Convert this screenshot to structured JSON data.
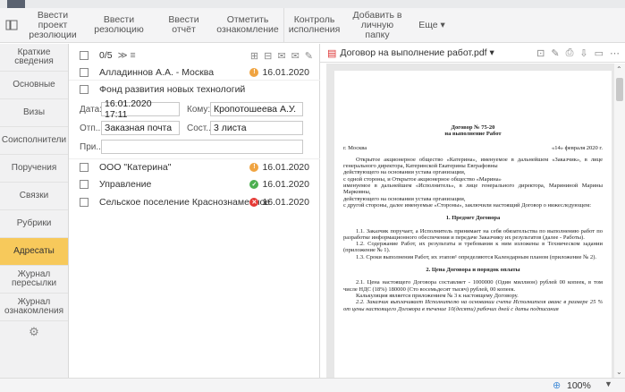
{
  "toolbar": {
    "items": [
      {
        "label1": "Ввести проект",
        "label2": "резолюции"
      },
      {
        "label1": "Ввести",
        "label2": "резолюцию"
      },
      {
        "label1": "Ввести отчёт",
        "label2": ""
      },
      {
        "label1": "Отметить",
        "label2": "ознакомление"
      },
      {
        "label1": "Контроль",
        "label2": "исполнения"
      },
      {
        "label1": "Добавить в",
        "label2": "личную папку"
      },
      {
        "label1": "Еще ▾",
        "label2": ""
      }
    ]
  },
  "sidebar": {
    "items": [
      {
        "l1": "Краткие",
        "l2": "сведения"
      },
      {
        "l1": "Основные",
        "l2": ""
      },
      {
        "l1": "Визы",
        "l2": ""
      },
      {
        "l1": "Соисполнители",
        "l2": ""
      },
      {
        "l1": "Поручения",
        "l2": ""
      },
      {
        "l1": "Связки",
        "l2": ""
      },
      {
        "l1": "Рубрики",
        "l2": ""
      },
      {
        "l1": "Адресаты",
        "l2": ""
      },
      {
        "l1": "Журнал",
        "l2": "пересылки"
      },
      {
        "l1": "Журнал",
        "l2": "ознакомления"
      }
    ],
    "active": "Адресаты",
    "gear_icon": "gear-icon"
  },
  "middle": {
    "counter": "0/5",
    "counter_arrow": "≫ ≡",
    "rows": [
      {
        "name": "Алладиннов А.А. - Москва",
        "date": "16.01.2020",
        "status_color": "#f0a441",
        "status_glyph": "!"
      },
      {
        "name": "Фонд развития новых технологий",
        "date": "",
        "status_color": "",
        "status_glyph": ""
      }
    ],
    "detail": {
      "date_label": "Дата:",
      "date_value": "16.01.2020 17:11",
      "to_label": "Кому:",
      "to_value": "Кропотошеева А.У.",
      "sent_label": "Отп...",
      "sent_value": "Заказная почта",
      "comp_label": "Сост...",
      "comp_value": "3 листа",
      "note_label": "При...",
      "note_value": ""
    },
    "rows2": [
      {
        "name": "ООО \"Катерина\"",
        "date": "16.01.2020",
        "status_color": "#f0a441",
        "status_glyph": "!"
      },
      {
        "name": "Управление",
        "date": "16.01.2020",
        "status_color": "#4caf50",
        "status_glyph": "✓"
      },
      {
        "name": "Сельское поселение Краснознаменное",
        "date": "16.01.2020",
        "status_color": "#e53935",
        "status_glyph": "✕"
      }
    ]
  },
  "viewer": {
    "filename": "Договор на выполнение работ.pdf ▾",
    "doc": {
      "title": "Договор № 75-20",
      "subtitle": "на выполнение Работ",
      "city": "г. Москва",
      "date": "«14» февраля 2020 г.",
      "para1": "Открытое акционерное общество «Катерина», именуемое в дальнейшем «Заказчик», в лице генерального директора, Катеринской Екатерины Евграфовны",
      "line1": "действующего на основании устава организации,",
      "line2": "с одной стороны, и Открытое акционерное общество «Марина»",
      "line3": "именуемое в дальнейшем «Исполнитель», в лице генерального директора, Марининой Марины Марковны,",
      "line4": "действующего на основании устава организации,",
      "line5": "с другой стороны, далее именуемые «Стороны», заключили настоящий Договор о нижеследующем:",
      "sec1": "1. Предмет Договора",
      "p11": "1.1. Заказчик поручает, а Исполнитель принимает на себя обязательства по выполнению работ по разработке информационного обеспечения и передаче Заказчику их результатов (далее - Работы).",
      "p12": "1.2. Содержание Работ, их результаты и требования к ним изложены в Техническом задании (приложение № 1).",
      "p13": "1.3. Сроки выполнения Работ, их этапов¹ определяются Календарным планом (приложение № 2).",
      "sec2": "2. Цена Договора и порядок оплаты",
      "p21": "2.1. Цена настоящего Договора составляет - 1000000 (Один миллион) рублей 00 копеек, в том числе НДС (18%) 180000 (Сто восемьдесят тысяч) рублей, 00 копеек.",
      "p21b": "Калькуляция является приложением № 3 к настоящему Договору.",
      "p22": "2.2. Заказчик выплачивает Исполнителю на основании счета Исполнителя аванс в размере 25 % от цены настоящего Договора в течение 10(десяти) рабочих дней с даты подписания"
    }
  },
  "statusbar": {
    "zoom": "100%",
    "zoom_icon": "zoom-in-icon"
  }
}
